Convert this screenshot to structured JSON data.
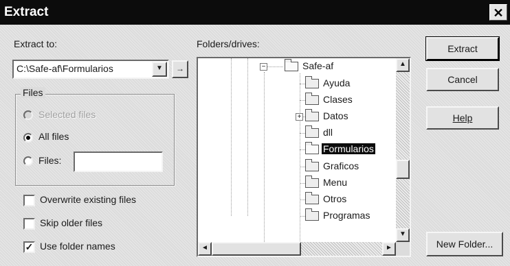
{
  "window": {
    "title": "Extract",
    "close_glyph": "✕"
  },
  "extract_to": {
    "label": "Extract to:",
    "value": "C:\\Safe-af\\Formularios",
    "dropdown_glyph": "▼",
    "browse_glyph": "→"
  },
  "files_group": {
    "title": "Files",
    "selected_label": "Selected files",
    "all_label": "All files",
    "files_label": "Files:",
    "files_value": "",
    "selected_option": "All files"
  },
  "options": [
    {
      "label": "Overwrite existing files",
      "checked": false
    },
    {
      "label": "Skip older files",
      "checked": false
    },
    {
      "label": "Use folder names",
      "checked": true
    }
  ],
  "folders": {
    "label": "Folders/drives:",
    "tree": [
      {
        "label": "Safe-af",
        "expander": "−",
        "open": true
      },
      {
        "label": "Ayuda"
      },
      {
        "label": "Clases"
      },
      {
        "label": "Datos",
        "expander": "+"
      },
      {
        "label": "dll"
      },
      {
        "label": "Formularios",
        "selected": true,
        "open": true
      },
      {
        "label": "Graficos"
      },
      {
        "label": "Menu"
      },
      {
        "label": "Otros"
      },
      {
        "label": "Programas"
      }
    ]
  },
  "buttons": {
    "extract": "Extract",
    "cancel": "Cancel",
    "help": "Help",
    "new_folder": "New Folder..."
  },
  "scroll": {
    "up": "▲",
    "down": "▼",
    "left": "◄",
    "right": "►"
  }
}
